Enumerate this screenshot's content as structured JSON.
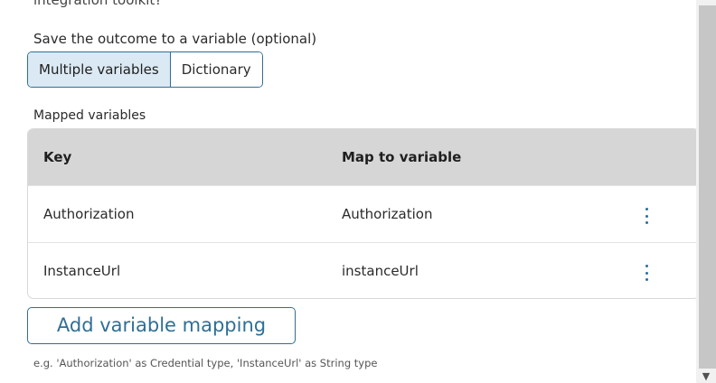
{
  "top_partial_text": "integration toolkit?",
  "outcome": {
    "label": "Save the outcome to a variable (optional)",
    "modes": [
      "Multiple variables",
      "Dictionary"
    ],
    "selected_mode": "Multiple variables"
  },
  "mapped": {
    "label": "Mapped variables",
    "headers": {
      "key": "Key",
      "map": "Map to variable"
    },
    "rows": [
      {
        "key": "Authorization",
        "map": "Authorization"
      },
      {
        "key": "InstanceUrl",
        "map": "instanceUrl"
      }
    ],
    "add_button": "Add variable mapping",
    "hint": "e.g. 'Authorization' as Credential type, 'InstanceUrl' as String type"
  },
  "colors": {
    "accent": "#2f6f95",
    "active_toggle_bg": "#dbe9f4",
    "header_bg": "#d6d6d6"
  },
  "icons": {
    "row_menu": "more-vertical-icon",
    "scroll_down": "chevron-down-icon"
  }
}
